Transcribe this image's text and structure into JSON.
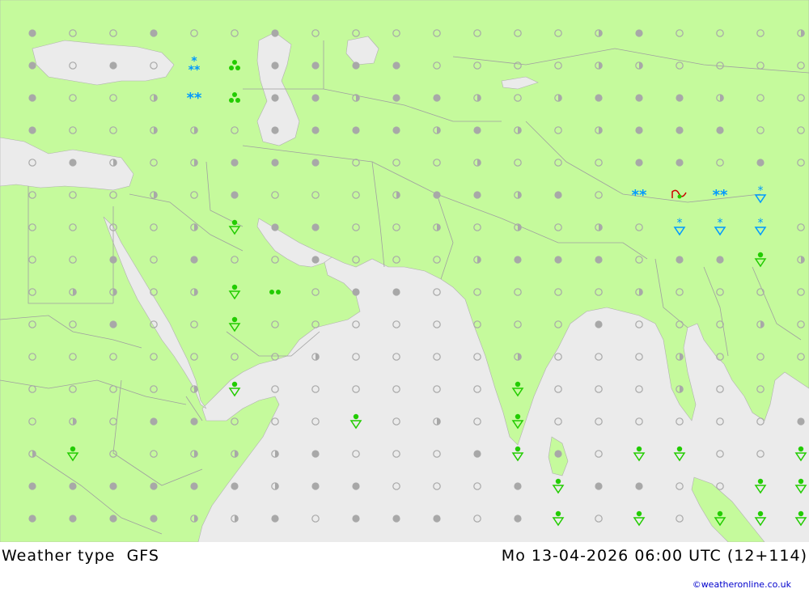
{
  "footer": {
    "product": "Weather type",
    "model": "GFS",
    "valid_time": "Mo 13-04-2026 06:00 UTC (12+114)",
    "credit": "©weatheronline.co.uk"
  },
  "colors": {
    "land": "#c5fa9c",
    "sea": "#ebebeb",
    "border": "#a0a0a0",
    "cloud_symbol": "#a8a8a8",
    "rain": "#22cc00",
    "snow": "#0099ff",
    "thunder": "#cc0000"
  },
  "legend_icons": [
    "clear-sky-icon",
    "partly-cloudy-icon",
    "overcast-icon",
    "rain-shower-icon",
    "snow-shower-icon",
    "snow-icon",
    "drizzle-icon",
    "rain-icon",
    "thunderstorm-icon"
  ],
  "grid_rows": [
    "cooRRoooocccocoooooossoocccocc",
    "cooccoooooooooooooooooooooooo",
    "oooocoooooooooooooooooooooooo"
  ]
}
